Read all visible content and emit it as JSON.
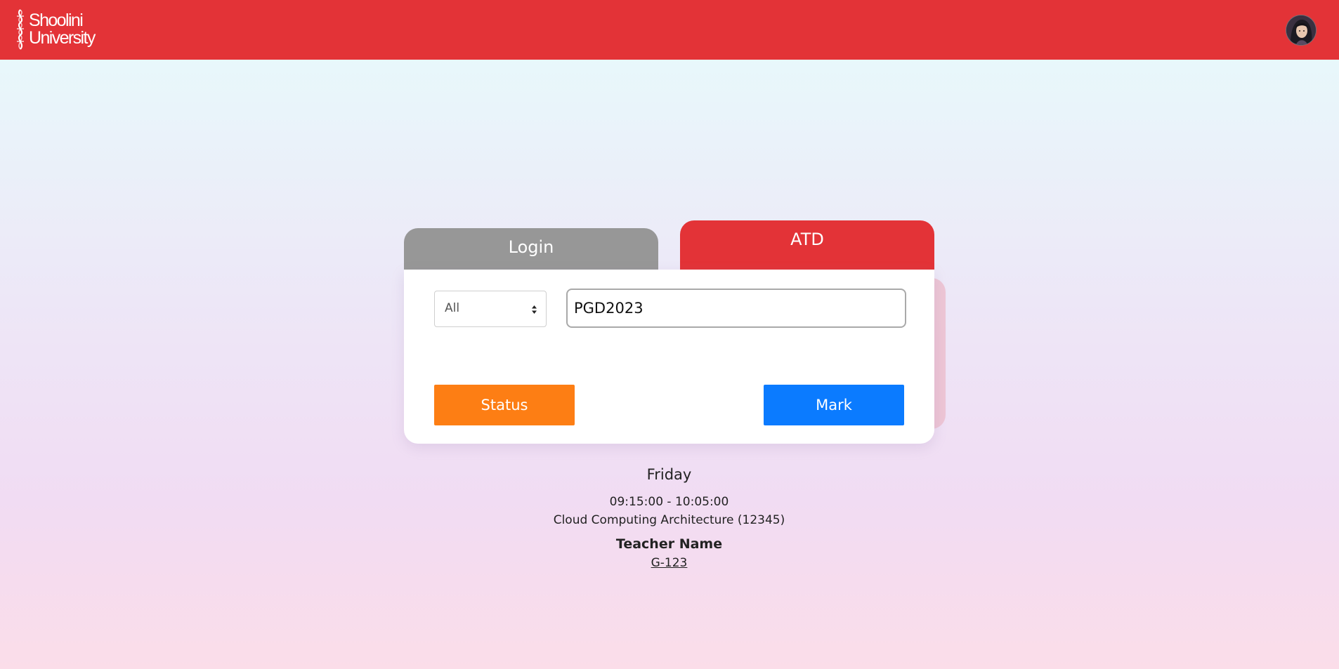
{
  "header": {
    "logo_line1": "Shoolini",
    "logo_line2": "University",
    "bar_color": "#e33337",
    "avatar_icon": "user-avatar"
  },
  "tabs": [
    {
      "label": "Login",
      "color": "#979797",
      "active": false
    },
    {
      "label": "ATD",
      "color": "#e33337",
      "active": true
    }
  ],
  "form": {
    "filter_select": {
      "selected": "All"
    },
    "code_input": {
      "value": "PGD2023"
    },
    "status_button": {
      "label": "Status",
      "color": "#fd7e14"
    },
    "mark_button": {
      "label": "Mark",
      "color": "#0b7bff"
    }
  },
  "schedule": {
    "day": "Friday",
    "time": "09:15:00 - 10:05:00",
    "course": "Cloud Computing Architecture (12345)",
    "teacher": "Teacher Name",
    "room": "G-123"
  }
}
